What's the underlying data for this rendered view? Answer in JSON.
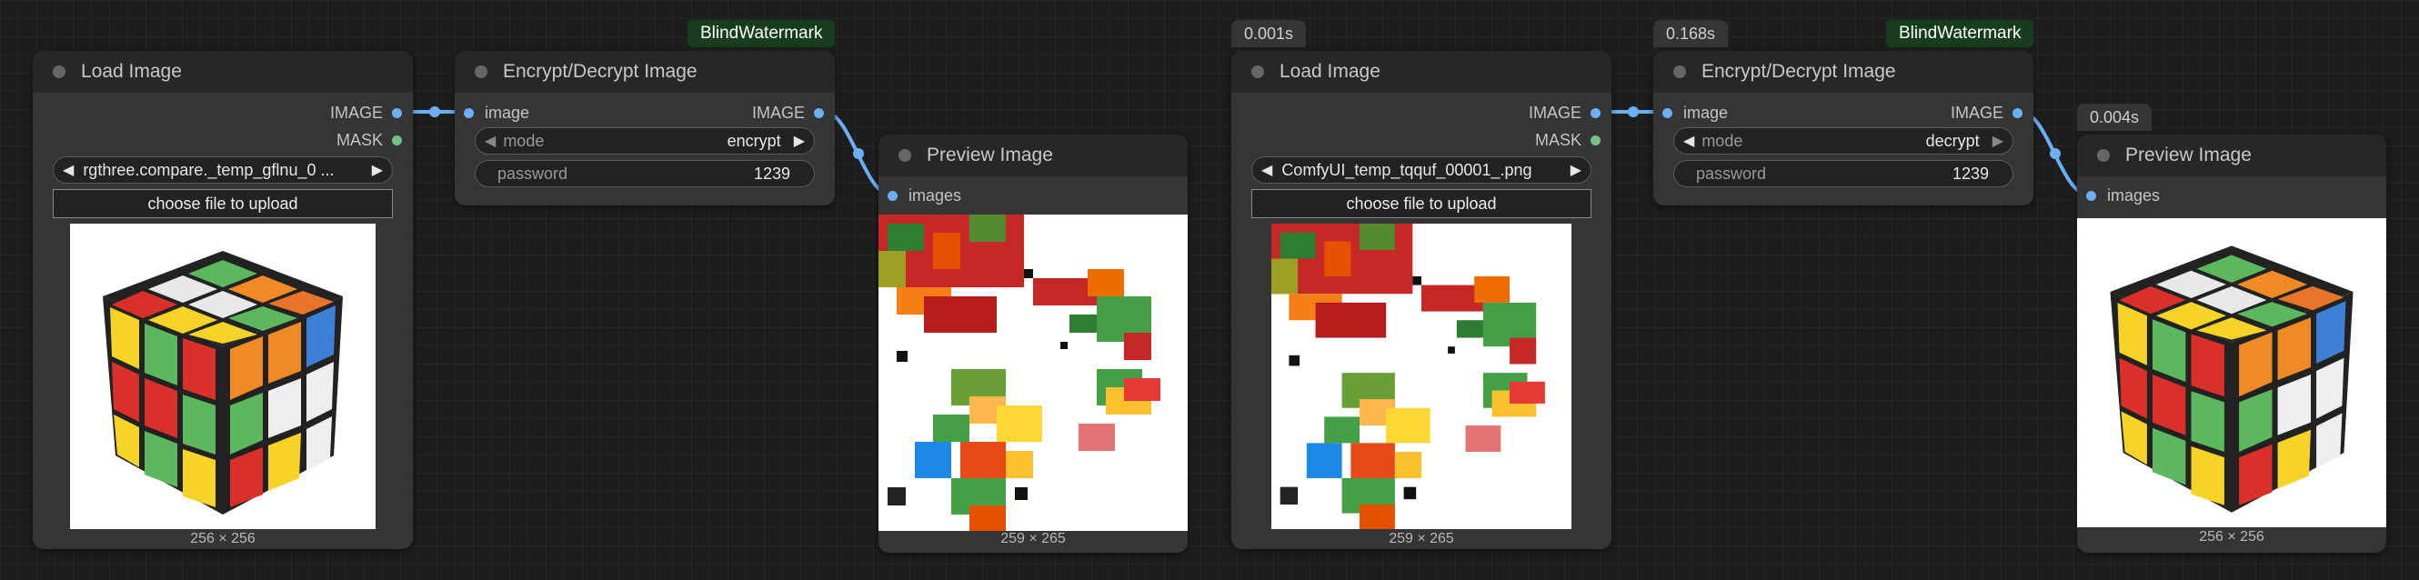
{
  "colors": {
    "image_slot": "#6ab0f3",
    "mask_slot": "#73c480",
    "wire": "#6ab0f3",
    "watermark_badge": "#173d1d"
  },
  "nodes": {
    "load1": {
      "title": "Load Image",
      "outputs": [
        "IMAGE",
        "MASK"
      ],
      "file": "rgthree.compare._temp_gflnu_0 ...",
      "upload": "choose file to upload",
      "image_icon": "rubiks-cube-image",
      "size": "256 × 256"
    },
    "enc1": {
      "badge": "BlindWatermark",
      "title": "Encrypt/Decrypt Image",
      "input": "image",
      "output": "IMAGE",
      "mode_label": "mode",
      "mode_value": "encrypt",
      "password_label": "password",
      "password_value": "1239"
    },
    "prev1": {
      "title": "Preview Image",
      "input": "images",
      "image_icon": "scrambled-image",
      "size": "259 × 265"
    },
    "load2": {
      "timing": "0.001s",
      "title": "Load Image",
      "outputs": [
        "IMAGE",
        "MASK"
      ],
      "file": "ComfyUI_temp_tqquf_00001_.png",
      "upload": "choose file to upload",
      "image_icon": "scrambled-image",
      "size": "259 × 265"
    },
    "enc2": {
      "timing": "0.168s",
      "badge": "BlindWatermark",
      "title": "Encrypt/Decrypt Image",
      "input": "image",
      "output": "IMAGE",
      "mode_label": "mode",
      "mode_value": "decrypt",
      "password_label": "password",
      "password_value": "1239"
    },
    "prev2": {
      "timing": "0.004s",
      "title": "Preview Image",
      "input": "images",
      "image_icon": "rubiks-cube-image",
      "size": "256 × 256"
    }
  }
}
